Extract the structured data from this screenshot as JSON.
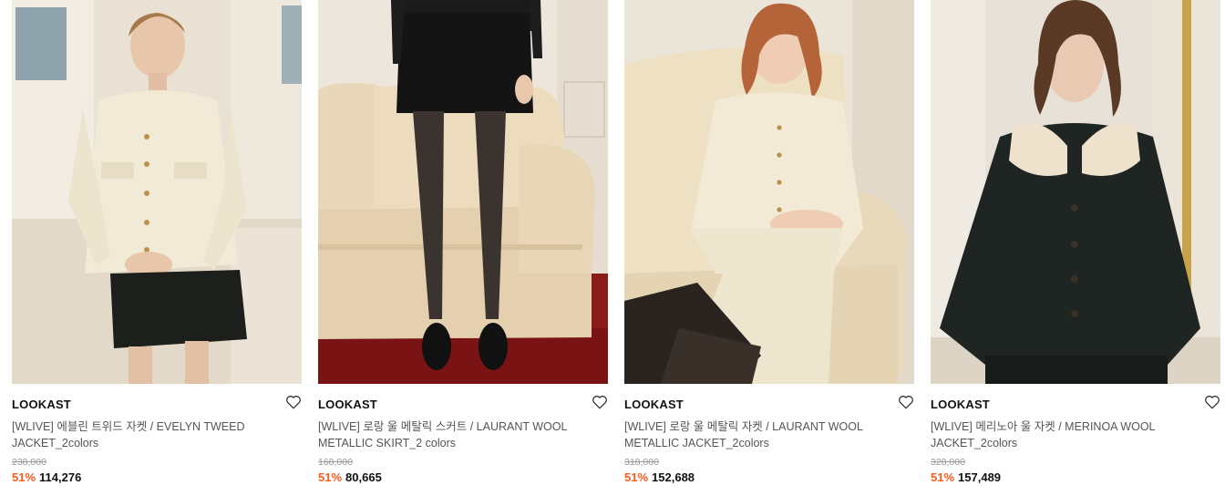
{
  "colors": {
    "discount": "#ff5b1a",
    "original_price": "#999999",
    "title": "#555555"
  },
  "products": [
    {
      "brand": "LOOKAST",
      "title": "[WLIVE] 에블린 트위드 자켓 / EVELYN TWEED JACKET_2colors",
      "original_price": "238,000",
      "discount": "51%",
      "price": "114,276",
      "wish_icon": "heart-outline"
    },
    {
      "brand": "LOOKAST",
      "title": "[WLIVE] 로랑 울 메탈릭 스커트 / LAURANT WOOL METALLIC SKIRT_2 colors",
      "original_price": "168,000",
      "discount": "51%",
      "price": "80,665",
      "wish_icon": "heart-outline"
    },
    {
      "brand": "LOOKAST",
      "title": "[WLIVE] 로랑 울 메탈릭 자켓 / LAURANT WOOL METALLIC JACKET_2colors",
      "original_price": "318,000",
      "discount": "51%",
      "price": "152,688",
      "wish_icon": "heart-outline"
    },
    {
      "brand": "LOOKAST",
      "title": "[WLIVE] 메리노아 울 자켓 / MERINOA WOOL JACKET_2colors",
      "original_price": "328,000",
      "discount": "51%",
      "price": "157,489",
      "wish_icon": "heart-outline"
    }
  ]
}
